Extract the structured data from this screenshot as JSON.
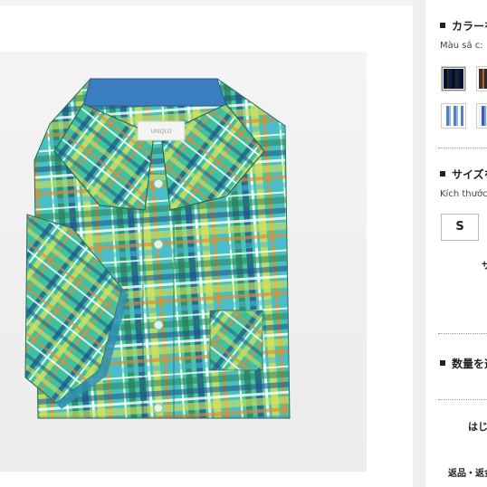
{
  "product": {
    "image_alt": "Plaid short-sleeve shirt",
    "brand_label": "UNIQLO"
  },
  "options": {
    "color_title": "カラーを",
    "color_subtitle": "Màu sắ c:",
    "size_title": "サイズを",
    "size_subtitle": "Kích thước",
    "selected_size": "S",
    "size_side_text": "サ",
    "quantity_title": "数量を選",
    "bottom_text_1": "はじ",
    "bottom_text_2": "返品・返金"
  },
  "swatches": [
    {
      "name": "swatch-navy-yellow-plaid",
      "colors": [
        "#2b3f6a",
        "#c9b24a",
        "#6a7c9a"
      ]
    },
    {
      "name": "swatch-brown-plaid",
      "colors": [
        "#4a2e25",
        "#a86a3c",
        "#2a2a2a"
      ]
    },
    {
      "name": "swatch-blue-white-plaid",
      "colors": [
        "#ffffff",
        "#4f7fc6",
        "#9cb6e0"
      ]
    },
    {
      "name": "swatch-blue-plaid",
      "colors": [
        "#e8eef8",
        "#3b5faa",
        "#7da2da"
      ]
    }
  ]
}
